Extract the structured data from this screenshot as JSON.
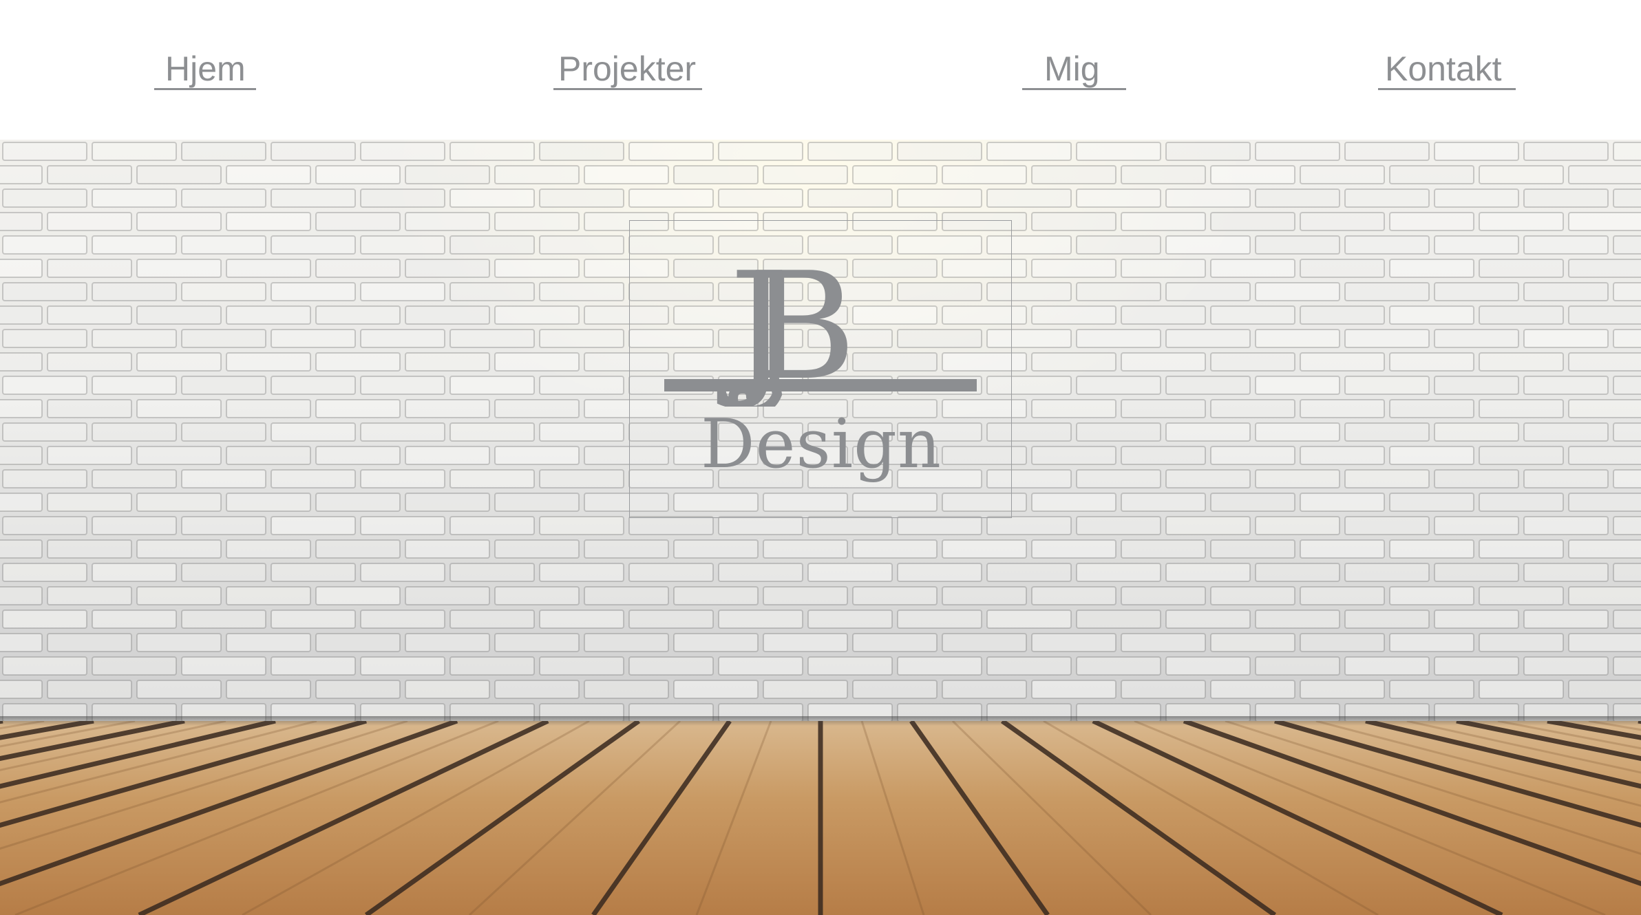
{
  "nav": {
    "items": [
      {
        "label": "Hjem"
      },
      {
        "label": "Projekter"
      },
      {
        "label": "Mig"
      },
      {
        "label": "Kontakt"
      }
    ]
  },
  "logo": {
    "monogram_j": "J",
    "monogram_b": "B",
    "wordmark": "Design"
  },
  "colors": {
    "text_gray": "#8d8f92",
    "background": "#ffffff"
  }
}
